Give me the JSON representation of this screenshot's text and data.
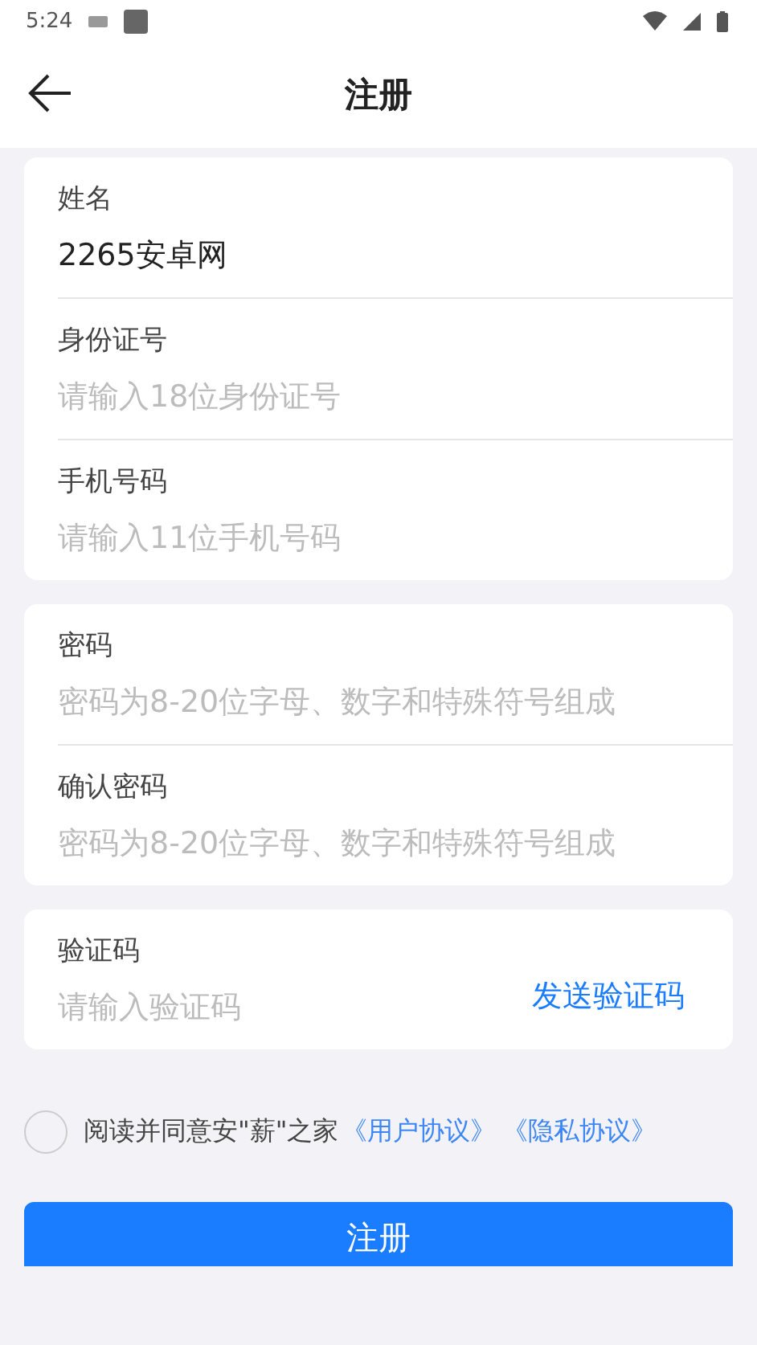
{
  "status_bar": {
    "time": "5:24"
  },
  "header": {
    "title": "注册"
  },
  "cards": [
    {
      "fields": [
        {
          "label": "姓名",
          "value": "2265安卓网"
        },
        {
          "label": "身份证号",
          "placeholder": "请输入18位身份证号"
        },
        {
          "label": "手机号码",
          "placeholder": "请输入11位手机号码"
        }
      ]
    },
    {
      "fields": [
        {
          "label": "密码",
          "placeholder": "密码为8-20位字母、数字和特殊符号组成"
        },
        {
          "label": "确认密码",
          "placeholder": "密码为8-20位字母、数字和特殊符号组成"
        }
      ]
    },
    {
      "fields": [
        {
          "label": "验证码",
          "placeholder": "请输入验证码",
          "action": "发送验证码"
        }
      ]
    }
  ],
  "agreement": {
    "checked": false,
    "text": "阅读并同意安\"薪\"之家",
    "links": [
      "《用户协议》",
      "《隐私协议》"
    ]
  },
  "submit": "注册"
}
